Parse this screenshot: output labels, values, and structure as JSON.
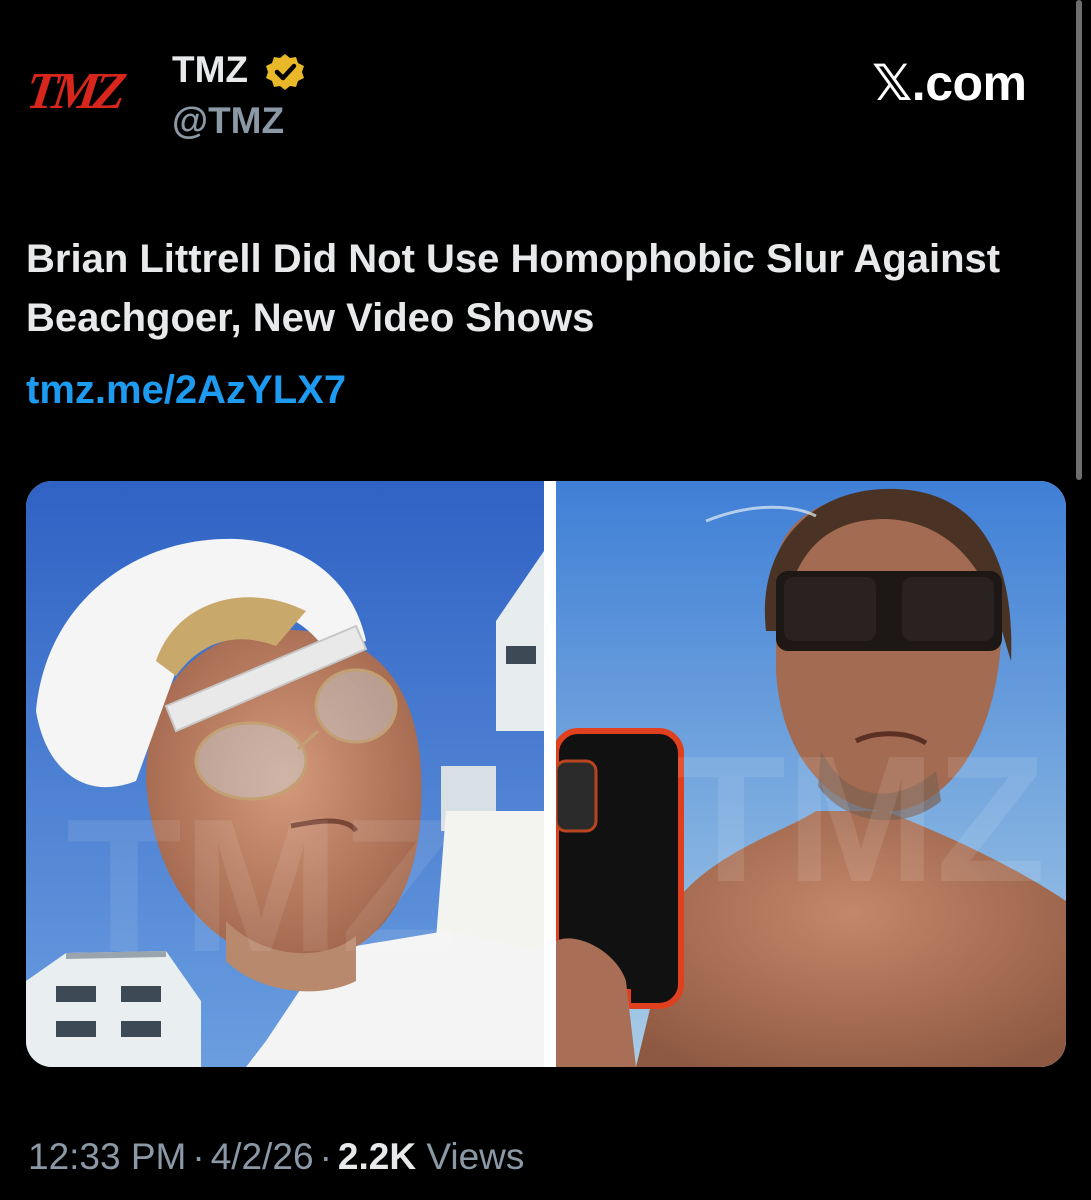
{
  "account": {
    "logo_text": "TMZ",
    "display_name": "TMZ",
    "handle": "@TMZ",
    "verified": true
  },
  "branding": {
    "site_label": ".com",
    "site_mark": "𝕏"
  },
  "post": {
    "headline": "Brian Littrell Did Not Use Homophobic Slur Against Beachgoer, New Video Shows",
    "link": "tmz.me/2AzYLX7",
    "media": {
      "left_image_watermark": "TMZ",
      "right_image_watermark": "TMZ"
    }
  },
  "meta": {
    "time": "12:33 PM",
    "date": "4/2/26",
    "separator": "·",
    "views_count": "2.2K",
    "views_label": "Views"
  },
  "colors": {
    "background": "#000000",
    "text_primary": "#e7e9ea",
    "text_secondary": "#8b98a5",
    "link": "#1d9bf0",
    "logo_red": "#d8261c",
    "verified_gold": "#e8b829"
  }
}
